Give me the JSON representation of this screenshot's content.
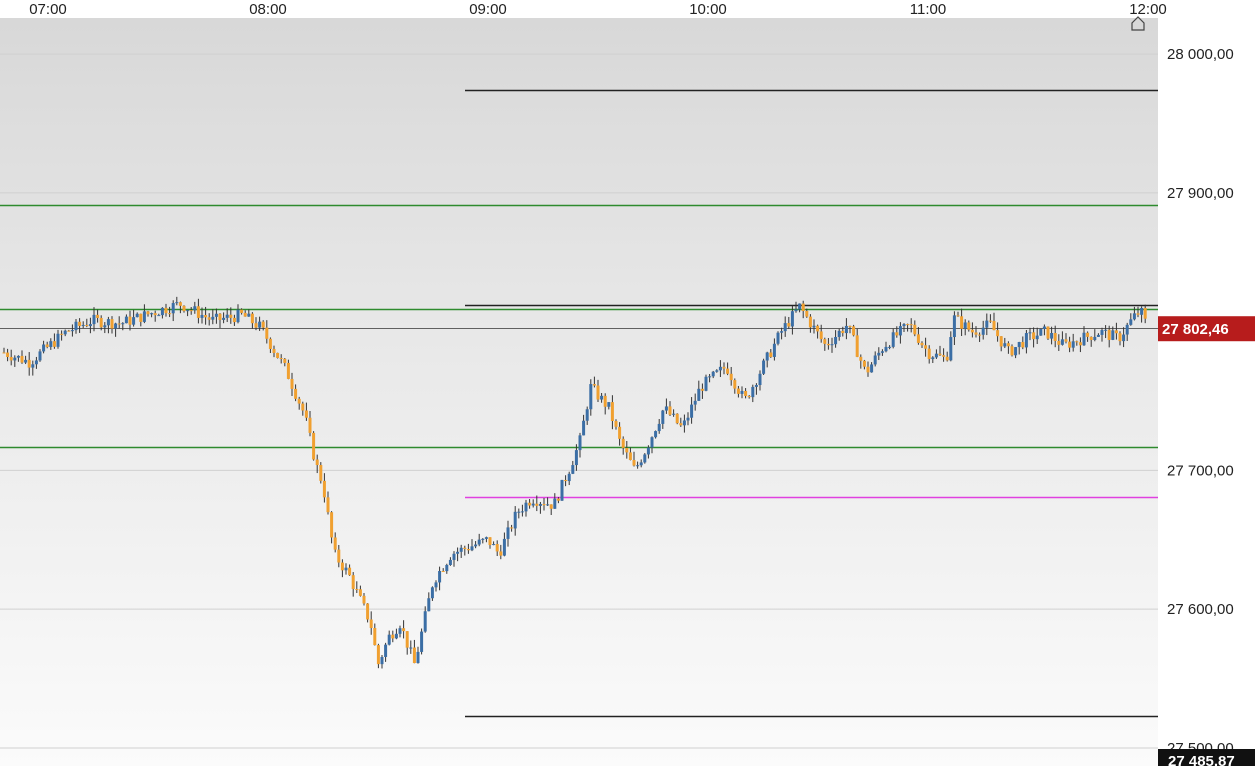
{
  "chart_data": {
    "type": "candlestick",
    "x_ticks": [
      "07:00",
      "08:00",
      "09:00",
      "10:00",
      "11:00",
      "12:00"
    ],
    "y_ticks": [
      {
        "value": 28000,
        "label": "28 000,00"
      },
      {
        "value": 27900,
        "label": "27 900,00"
      },
      {
        "value": 27700,
        "label": "27 700,00"
      },
      {
        "value": 27600,
        "label": "27 600,00"
      },
      {
        "value": 27500,
        "label": "27 500,00"
      }
    ],
    "ylim": [
      27487,
      28026
    ],
    "grid": true,
    "current_price": {
      "value": 27802.46,
      "label": "27 802,46",
      "color": "#b71c1c"
    },
    "low_marker": {
      "value": 27485.87,
      "label": "27 485,87",
      "color": "#111111"
    },
    "levels": [
      {
        "value": 27974,
        "color": "#222222",
        "from_time": "09:00"
      },
      {
        "value": 27891,
        "color": "#2e8b2e",
        "from_time": "07:00"
      },
      {
        "value": 27819,
        "color": "#222222",
        "from_time": "09:00"
      },
      {
        "value": 27816,
        "color": "#2e8b2e",
        "from_time": "07:00"
      },
      {
        "value": 27717,
        "color": "#2e8b2e",
        "from_time": "07:00"
      },
      {
        "value": 27681,
        "color": "#e040e0",
        "from_time": "09:00"
      },
      {
        "value": 27523,
        "color": "#222222",
        "from_time": "09:00"
      },
      {
        "value": 27486,
        "color": "#2e8b2e",
        "from_time": "07:00"
      }
    ],
    "colors": {
      "up": "#3b6ea5",
      "down": "#f0a030",
      "wick": "#333333"
    },
    "path": [
      [
        "06:48",
        27785
      ],
      [
        "06:55",
        27778
      ],
      [
        "07:05",
        27800
      ],
      [
        "07:12",
        27808
      ],
      [
        "07:20",
        27806
      ],
      [
        "07:30",
        27815
      ],
      [
        "07:36",
        27820
      ],
      [
        "07:45",
        27808
      ],
      [
        "07:53",
        27812
      ],
      [
        "07:58",
        27803
      ],
      [
        "08:05",
        27772
      ],
      [
        "08:10",
        27740
      ],
      [
        "08:13",
        27705
      ],
      [
        "08:15",
        27690
      ],
      [
        "08:18",
        27640
      ],
      [
        "08:22",
        27625
      ],
      [
        "08:28",
        27590
      ],
      [
        "08:30",
        27560
      ],
      [
        "08:33",
        27580
      ],
      [
        "08:36",
        27590
      ],
      [
        "08:40",
        27560
      ],
      [
        "08:45",
        27620
      ],
      [
        "08:50",
        27640
      ],
      [
        "08:55",
        27645
      ],
      [
        "09:00",
        27650
      ],
      [
        "09:03",
        27640
      ],
      [
        "09:08",
        27670
      ],
      [
        "09:12",
        27680
      ],
      [
        "09:18",
        27675
      ],
      [
        "09:22",
        27700
      ],
      [
        "09:25",
        27720
      ],
      [
        "09:28",
        27760
      ],
      [
        "09:33",
        27745
      ],
      [
        "09:36",
        27720
      ],
      [
        "09:40",
        27700
      ],
      [
        "09:43",
        27715
      ],
      [
        "09:48",
        27745
      ],
      [
        "09:53",
        27730
      ],
      [
        "09:58",
        27760
      ],
      [
        "10:05",
        27775
      ],
      [
        "10:10",
        27750
      ],
      [
        "10:15",
        27775
      ],
      [
        "10:20",
        27800
      ],
      [
        "10:25",
        27818
      ],
      [
        "10:32",
        27790
      ],
      [
        "10:38",
        27805
      ],
      [
        "10:43",
        27770
      ],
      [
        "10:48",
        27790
      ],
      [
        "10:55",
        27805
      ],
      [
        "11:00",
        27785
      ],
      [
        "11:05",
        27780
      ],
      [
        "11:07",
        27810
      ],
      [
        "11:12",
        27800
      ],
      [
        "11:17",
        27805
      ],
      [
        "11:22",
        27785
      ],
      [
        "11:27",
        27795
      ],
      [
        "11:32",
        27800
      ],
      [
        "11:37",
        27790
      ],
      [
        "11:42",
        27795
      ],
      [
        "11:47",
        27800
      ],
      [
        "11:52",
        27795
      ],
      [
        "11:56",
        27810
      ],
      [
        "11:58",
        27815
      ],
      [
        "12:00",
        27802
      ]
    ]
  }
}
